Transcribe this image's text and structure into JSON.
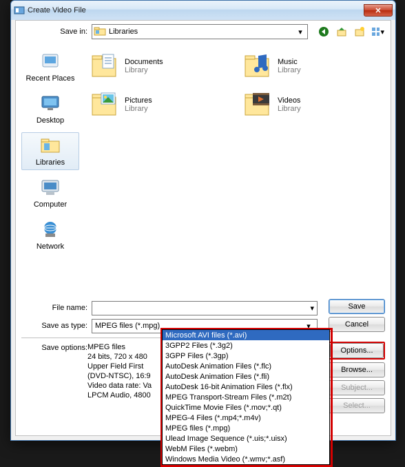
{
  "window": {
    "title": "Create Video File",
    "close_glyph": "✕"
  },
  "savein": {
    "label": "Save in:",
    "value": "Libraries"
  },
  "nav": {
    "back": "back-icon",
    "up": "up-icon",
    "newfolder": "new-folder-icon",
    "views": "views-icon"
  },
  "places": [
    {
      "label": "Recent Places",
      "icon": "recent"
    },
    {
      "label": "Desktop",
      "icon": "desktop"
    },
    {
      "label": "Libraries",
      "icon": "libraries",
      "selected": true
    },
    {
      "label": "Computer",
      "icon": "computer"
    },
    {
      "label": "Network",
      "icon": "network"
    }
  ],
  "folders": [
    {
      "name": "Documents",
      "sub": "Library",
      "icon": "doc"
    },
    {
      "name": "Music",
      "sub": "Library",
      "icon": "music"
    },
    {
      "name": "Pictures",
      "sub": "Library",
      "icon": "pic"
    },
    {
      "name": "Videos",
      "sub": "Library",
      "icon": "video"
    }
  ],
  "filename": {
    "label": "File name:",
    "value": ""
  },
  "saveastype": {
    "label": "Save as type:",
    "selected": "MPEG files (*.mpg)"
  },
  "dropdown_options": [
    "Microsoft AVI files (*.avi)",
    "3GPP2 Files (*.3g2)",
    "3GPP Files (*.3gp)",
    "AutoDesk Animation Files (*.flc)",
    "AutoDesk Animation Files (*.fli)",
    "AutoDesk 16-bit Animation Files (*.flx)",
    "MPEG Transport-Stream Files (*.m2t)",
    "QuickTime Movie Files (*.mov;*.qt)",
    "MPEG-4 Files (*.mp4;*.m4v)",
    "MPEG files (*.mpg)",
    "Ulead Image Sequence (*.uis;*.uisx)",
    "WebM Files (*.webm)",
    "Windows Media Video (*.wmv;*.asf)"
  ],
  "dropdown_selected_index": 0,
  "buttons": {
    "save": "Save",
    "cancel": "Cancel",
    "options": "Options...",
    "browse": "Browse...",
    "subject": "Subject...",
    "select": "Select..."
  },
  "saveoptions": {
    "label": "Save options:",
    "lines": [
      "MPEG files",
      "24 bits, 720 x 480",
      "Upper Field First",
      "(DVD-NTSC), 16:9",
      "Video data rate: Va",
      "LPCM Audio, 4800"
    ]
  }
}
